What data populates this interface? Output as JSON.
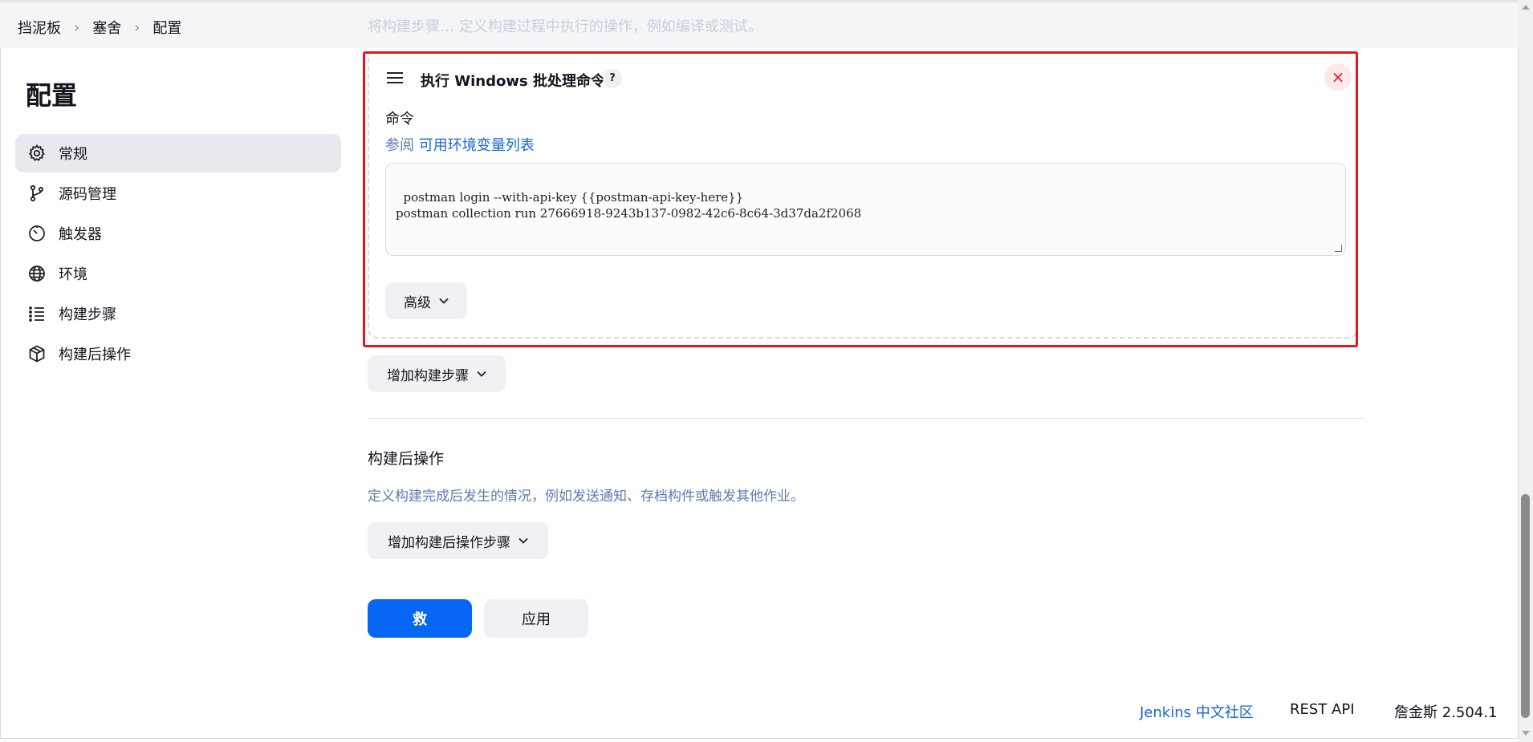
{
  "breadcrumbs": [
    "挡泥板",
    "塞舍",
    "配置"
  ],
  "faded_top_text": "将构建步骤…  定义构建过程中执行的操作，例如编译或测试。",
  "page_title": "配置",
  "sidebar": {
    "items": [
      {
        "label": "常规",
        "icon": "gear-icon",
        "active": true
      },
      {
        "label": "源码管理",
        "icon": "branch-icon",
        "active": false
      },
      {
        "label": "触发器",
        "icon": "clock-icon",
        "active": false
      },
      {
        "label": "环境",
        "icon": "globe-icon",
        "active": false
      },
      {
        "label": "构建步骤",
        "icon": "list-icon",
        "active": false
      },
      {
        "label": "构建后操作",
        "icon": "package-icon",
        "active": false
      }
    ]
  },
  "build_step": {
    "title": "执行 Windows 批处理命令",
    "help_label": "?",
    "close_label": "×",
    "command_label": "命令",
    "env_prefix": "参阅",
    "env_link": "可用环境变量列表",
    "command_value": "postman login --with-api-key {{postman-api-key-here}}\npostman collection run 27666918-9243b137-0982-42c6-8c64-3d37da2f2068",
    "advanced_label": "高级"
  },
  "add_build_step_label": "增加构建步骤",
  "post_build": {
    "title": "构建后操作",
    "description": "定义构建完成后发生的情况，例如发送通知、存档构件或触发其他作业。",
    "add_label": "增加构建后操作步骤"
  },
  "actions": {
    "save_label": "救",
    "apply_label": "应用"
  },
  "footer": {
    "community": "Jenkins 中文社区",
    "rest_api": "REST API",
    "version": "詹金斯 2.504.1"
  },
  "colors": {
    "primary": "#0766f5",
    "highlight_border": "#e8161a",
    "link": "#1967d2"
  }
}
